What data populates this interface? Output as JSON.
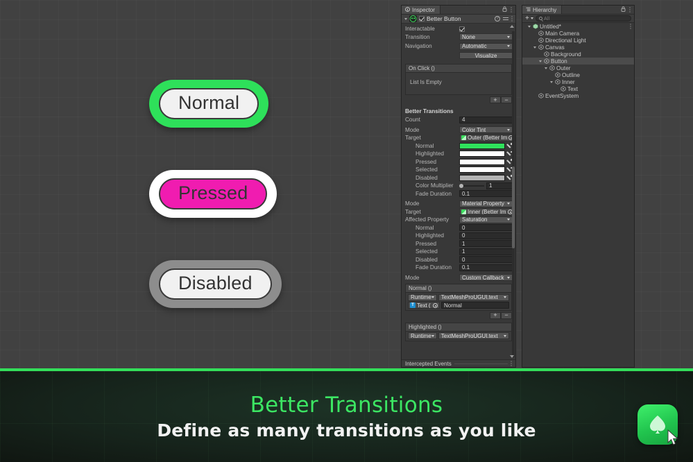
{
  "scene": {
    "buttons": [
      {
        "label": "Normal",
        "outer_color": "#2ee05a",
        "inner_color": "#f1f1f1",
        "text_color": "#333333"
      },
      {
        "label": "Pressed",
        "outer_color": "#ffffff",
        "inner_color": "#f01cb0",
        "text_color": "#333333"
      },
      {
        "label": "Disabled",
        "outer_color": "#8d8d8d",
        "inner_color": "#f1f1f1",
        "text_color": "#333333"
      }
    ]
  },
  "inspector": {
    "tab_label": "Inspector",
    "lock_icon": "lock-icon",
    "menu_icon": "kebab-menu-icon",
    "component": {
      "title": "Better Button",
      "script_badge": "script-icon",
      "enabled": true,
      "help_icon": "help-icon",
      "preset_icon": "preset-icon",
      "menu_icon": "kebab-menu-icon"
    },
    "fields": {
      "interactable_label": "Interactable",
      "interactable_value": true,
      "transition_label": "Transition",
      "transition_value": "None",
      "navigation_label": "Navigation",
      "navigation_value": "Automatic",
      "visualize_label": "Visualize"
    },
    "on_click": {
      "header": "On Click ()",
      "empty_text": "List Is Empty",
      "add_label": "+",
      "remove_label": "−"
    },
    "better_transitions": {
      "section_title": "Better Transitions",
      "count_label": "Count",
      "count_value": "4",
      "transitions": [
        {
          "mode_label": "Mode",
          "mode_value": "Color Tint",
          "target_label": "Target",
          "target_value": "Outer (Better Im",
          "states": [
            {
              "label": "Normal",
              "color": "#2fe25c"
            },
            {
              "label": "Highlighted",
              "color": "#ffffff"
            },
            {
              "label": "Pressed",
              "color": "#ffffff"
            },
            {
              "label": "Selected",
              "color": "#ffffff"
            },
            {
              "label": "Disabled",
              "color": "#b4b4b4"
            }
          ],
          "color_multiplier_label": "Color Multiplier",
          "color_multiplier_value": "1",
          "fade_duration_label": "Fade Duration",
          "fade_duration_value": "0.1"
        },
        {
          "mode_label": "Mode",
          "mode_value": "Material Property",
          "target_label": "Target",
          "target_value": "Inner (Better Im",
          "affected_property_label": "Affected Property",
          "affected_property_value": "Saturation",
          "states": [
            {
              "label": "Normal",
              "value": "0"
            },
            {
              "label": "Highlighted",
              "value": "0"
            },
            {
              "label": "Pressed",
              "value": "1"
            },
            {
              "label": "Selected",
              "value": "1"
            },
            {
              "label": "Disabled",
              "value": "0"
            }
          ],
          "fade_duration_label": "Fade Duration",
          "fade_duration_value": "0.1"
        },
        {
          "mode_label": "Mode",
          "mode_value": "Custom Callback",
          "events": [
            {
              "header": "Normal ()",
              "runtime": "Runtime",
              "function": "TextMeshProUGUI.text",
              "object": "Text (",
              "object_icon": "text-mesh-pro-icon",
              "value": "Normal",
              "add_label": "+",
              "remove_label": "−"
            },
            {
              "header": "Highlighted ()",
              "runtime": "Runtime",
              "function": "TextMeshProUGUI.text"
            }
          ]
        }
      ]
    },
    "footer": {
      "label": "Intercepted Events",
      "menu_icon": "kebab-menu-icon"
    }
  },
  "hierarchy": {
    "tab_label": "Hierarchy",
    "lock_icon": "lock-icon",
    "menu_icon": "kebab-menu-icon",
    "toolbar": {
      "add_label": "+",
      "add_caret": "chevron-down-icon",
      "search_icon": "search-icon",
      "search_placeholder": "All",
      "search_value": ""
    },
    "tree": [
      {
        "label": "Untitled*",
        "depth": 0,
        "icon": "scene-icon",
        "expanded": true,
        "selected": false,
        "has_menu": true
      },
      {
        "label": "Main Camera",
        "depth": 1,
        "icon": "gameobject-icon",
        "expanded": null,
        "selected": false,
        "has_menu": false
      },
      {
        "label": "Directional Light",
        "depth": 1,
        "icon": "gameobject-icon",
        "expanded": null,
        "selected": false,
        "has_menu": false
      },
      {
        "label": "Canvas",
        "depth": 1,
        "icon": "gameobject-icon",
        "expanded": true,
        "selected": false,
        "has_menu": false
      },
      {
        "label": "Background",
        "depth": 2,
        "icon": "gameobject-icon",
        "expanded": null,
        "selected": false,
        "has_menu": false
      },
      {
        "label": "Button",
        "depth": 2,
        "icon": "gameobject-icon",
        "expanded": true,
        "selected": true,
        "has_menu": false
      },
      {
        "label": "Outer",
        "depth": 3,
        "icon": "gameobject-icon",
        "expanded": true,
        "selected": false,
        "has_menu": false
      },
      {
        "label": "Outline",
        "depth": 4,
        "icon": "gameobject-icon",
        "expanded": null,
        "selected": false,
        "has_menu": false
      },
      {
        "label": "Inner",
        "depth": 4,
        "icon": "gameobject-icon",
        "expanded": true,
        "selected": false,
        "has_menu": false
      },
      {
        "label": "Text",
        "depth": 5,
        "icon": "gameobject-icon",
        "expanded": null,
        "selected": false,
        "has_menu": false
      },
      {
        "label": "EventSystem",
        "depth": 1,
        "icon": "gameobject-icon",
        "expanded": null,
        "selected": false,
        "has_menu": false
      }
    ]
  },
  "banner": {
    "title": "Better Transitions",
    "subtitle": "Define as many transitions as you like",
    "accent_color": "#33e05a",
    "logo_icon": "spade-logo-icon",
    "cursor_icon": "mouse-cursor-icon"
  }
}
